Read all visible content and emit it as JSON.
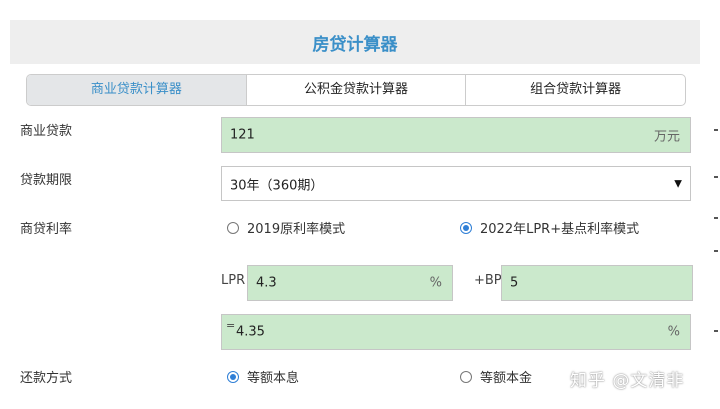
{
  "header": {
    "title": "房贷计算器"
  },
  "tabs": [
    {
      "label": "商业贷款计算器",
      "active": true
    },
    {
      "label": "公积金贷款计算器",
      "active": false
    },
    {
      "label": "组合贷款计算器",
      "active": false
    }
  ],
  "loan": {
    "label": "商业贷款",
    "value": "121",
    "unit": "万元"
  },
  "term": {
    "label": "贷款期限",
    "selected": "30年（360期）"
  },
  "rate": {
    "label": "商贷利率",
    "mode_old": "2019原利率模式",
    "mode_new": "2022年LPR+基点利率模式",
    "selected_mode": "2022年LPR+基点利率模式",
    "lpr_label": "LPR",
    "lpr_value": "4.3",
    "lpr_unit": "%",
    "bp_label": "+BP",
    "bp_value": "5",
    "eq_sign": "=",
    "result_value": "4.35",
    "result_unit": "%"
  },
  "repayment": {
    "label": "还款方式",
    "option_1": "等额本息",
    "option_2": "等额本金",
    "selected": "等额本息"
  },
  "watermark": "知乎 @文清非",
  "colors": {
    "accent": "#3a8fc8",
    "field_bg": "#cbe9cc",
    "radio": "#2f7fd6"
  }
}
